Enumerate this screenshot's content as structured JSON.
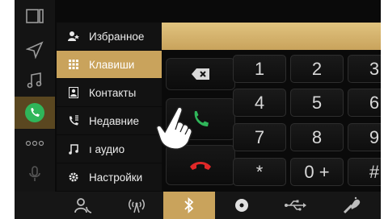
{
  "menu": {
    "items": [
      {
        "label": "Избранное",
        "icon": "favorites-icon"
      },
      {
        "label": "Клавиши",
        "icon": "keypad-icon",
        "selected": true
      },
      {
        "label": "Контакты",
        "icon": "contacts-icon"
      },
      {
        "label": "Недавние",
        "icon": "recent-calls-icon"
      },
      {
        "label": "ı аудио",
        "icon": "music-icon"
      },
      {
        "label": "Настройки",
        "icon": "settings-icon"
      }
    ]
  },
  "keypad": {
    "keys": [
      "1",
      "2",
      "3",
      "4",
      "5",
      "6",
      "7",
      "8",
      "9",
      "*",
      "0 +",
      "#"
    ]
  },
  "rail": {
    "items": [
      "window-icon",
      "navigation-icon",
      "music-icon",
      "phone-icon",
      "more-icon",
      "microphone-icon",
      "back-icon"
    ],
    "active": "phone-icon"
  },
  "bottom_bar": {
    "items": [
      "contact-icon",
      "antenna-icon",
      "bluetooth-icon",
      "disc-icon",
      "usb-icon",
      "aux-icon"
    ],
    "active": "bluetooth-icon"
  },
  "colors": {
    "accent": "#c9a35c",
    "call_green": "#2fb65a",
    "end_red": "#e02828",
    "background": "#0a0a0a"
  }
}
